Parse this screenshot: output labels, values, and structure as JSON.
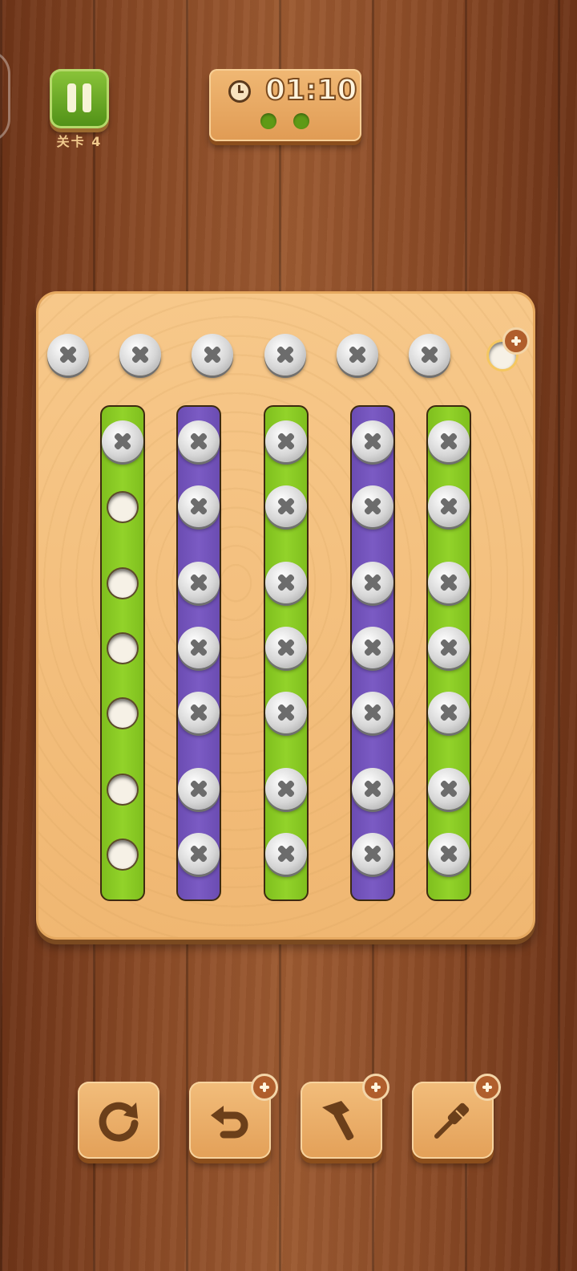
{
  "header": {
    "level_label": "关卡 4",
    "timer": "01:10",
    "progress_dots": 2,
    "icons": [
      "pause-icon",
      "clock-icon"
    ]
  },
  "board": {
    "top_screws": 6,
    "top_empty_slots": 1,
    "strips": [
      {
        "color": "green",
        "screws": 1,
        "empty_holes": 6
      },
      {
        "color": "purple",
        "screws": 7,
        "empty_holes": 0
      },
      {
        "color": "green",
        "screws": 7,
        "empty_holes": 0
      },
      {
        "color": "purple",
        "screws": 7,
        "empty_holes": 0
      },
      {
        "color": "green",
        "screws": 7,
        "empty_holes": 0
      }
    ],
    "colors": {
      "green": "#8bc926",
      "purple": "#7356bd",
      "board": "#f3be7d"
    }
  },
  "tools": [
    {
      "name": "restart",
      "icon": "restart-icon",
      "has_add_badge": false
    },
    {
      "name": "undo",
      "icon": "undo-icon",
      "has_add_badge": true
    },
    {
      "name": "hammer",
      "icon": "hammer-icon",
      "has_add_badge": true
    },
    {
      "name": "screwdriver",
      "icon": "screwdriver-icon",
      "has_add_badge": true
    }
  ]
}
